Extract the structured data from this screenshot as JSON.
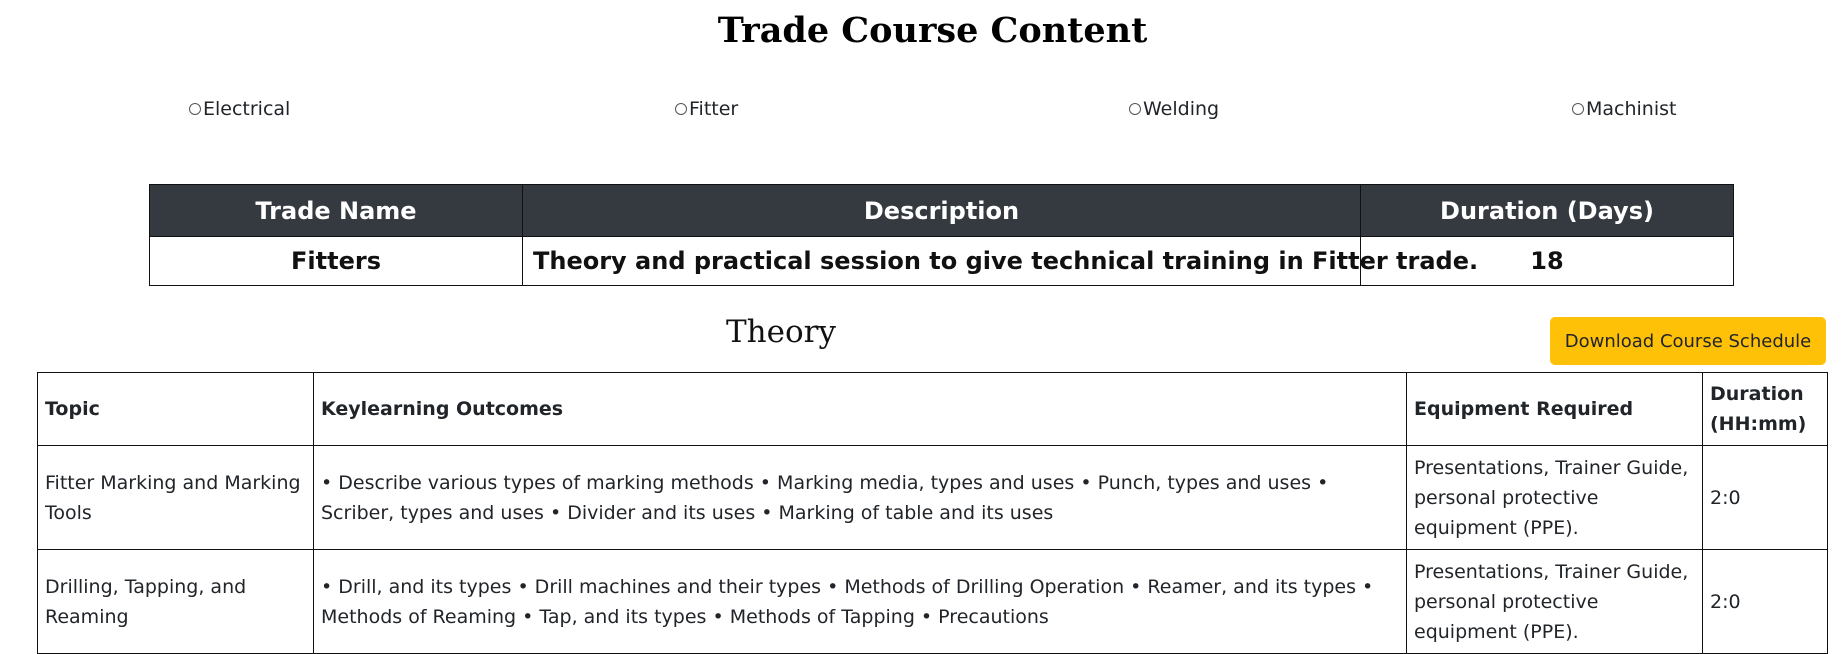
{
  "page": {
    "title": "Trade Course Content"
  },
  "trades": [
    {
      "label": "Electrical"
    },
    {
      "label": "Fitter"
    },
    {
      "label": "Welding"
    },
    {
      "label": "Machinist"
    }
  ],
  "summary": {
    "headers": [
      "Trade Name",
      "Description",
      "Duration (Days)"
    ],
    "row": {
      "trade_name": "Fitters",
      "description": "Theory and practical session to give technical training in Fitter trade.",
      "duration_days": "18"
    }
  },
  "theory": {
    "title": "Theory",
    "download_label": "Download Course Schedule",
    "headers": [
      "Topic",
      "Keylearning Outcomes",
      "Equipment Required",
      "Duration (HH:mm)"
    ],
    "rows": [
      {
        "topic": "Fitter Marking and Marking Tools",
        "outcomes": "• Describe various types of marking methods • Marking media, types and uses • Punch, types and uses • Scriber, types and uses • Divider and its uses • Marking of table and its uses",
        "equipment": "Presentations, Trainer Guide, personal protective equipment (PPE).",
        "duration": "2:0"
      },
      {
        "topic": "Drilling, Tapping, and Reaming",
        "outcomes": "• Drill, and its types • Drill machines and their types • Methods of Drilling Operation • Reamer, and its types • Methods of Reaming • Tap, and its types • Methods of Tapping • Precautions",
        "equipment": "Presentations, Trainer Guide, personal protective equipment (PPE).",
        "duration": "2:0"
      }
    ]
  }
}
